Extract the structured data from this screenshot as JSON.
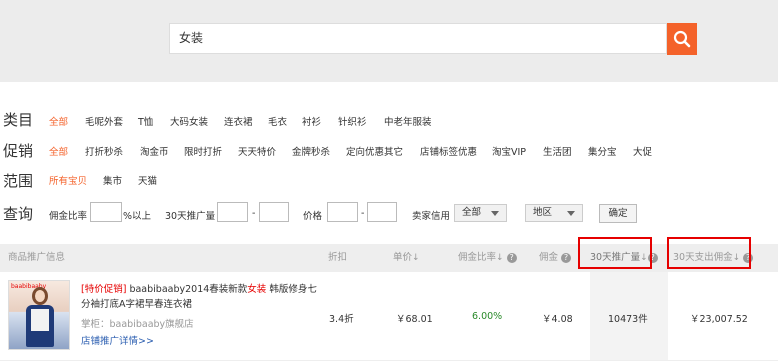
{
  "search": {
    "query": "女装"
  },
  "filters": {
    "category": {
      "label": "类目",
      "options": [
        "全部",
        "毛呢外套",
        "T恤",
        "大码女装",
        "连衣裙",
        "毛衣",
        "衬衫",
        "针织衫",
        "中老年服装"
      ]
    },
    "promotion": {
      "label": "促销",
      "options": [
        "全部",
        "打折秒杀",
        "淘金币",
        "限时打折",
        "天天特价",
        "金牌秒杀",
        "定向优惠其它",
        "店铺标签优惠",
        "淘宝VIP",
        "生活团",
        "集分宝",
        "大促"
      ]
    },
    "scope": {
      "label": "范围",
      "options": [
        "所有宝贝",
        "集市",
        "天猫"
      ]
    }
  },
  "query": {
    "label": "查询",
    "commission_rate": "佣金比率",
    "percent_above": "%以上",
    "promo_volume_30d": "30天推广量",
    "dash": "-",
    "price": "价格",
    "seller_credit": "卖家信用",
    "credit_select": "全部",
    "region_select": "地区",
    "confirm": "确定"
  },
  "table": {
    "headers": {
      "info": "商品推广信息",
      "discount": "折扣",
      "price": "单价",
      "rate": "佣金比率",
      "commission": "佣金",
      "promo30": "30天推广量",
      "paid30": "30天支出佣金"
    },
    "row": {
      "promo_tag": "[特价促销]",
      "title_pre": " baabibaaby2014春装新款",
      "title_kw": "女装",
      "title_post": " 韩版修身七分袖打底A字裙早春连衣裙",
      "shop": "掌柜：baabibaaby旗舰店",
      "detail_link": "店铺推广详情>>",
      "thumb_tag": "baabibaaby",
      "discount": "3.4折",
      "price": "￥68.01",
      "rate": "6.00%",
      "commission": "￥4.08",
      "promo30": "10473件",
      "paid30": "￥23,007.52"
    }
  },
  "colors": {
    "accent": "#f4622a",
    "highlight_box": "#e60000",
    "link": "#2a5db0",
    "rate_green": "#2a8a2a"
  }
}
